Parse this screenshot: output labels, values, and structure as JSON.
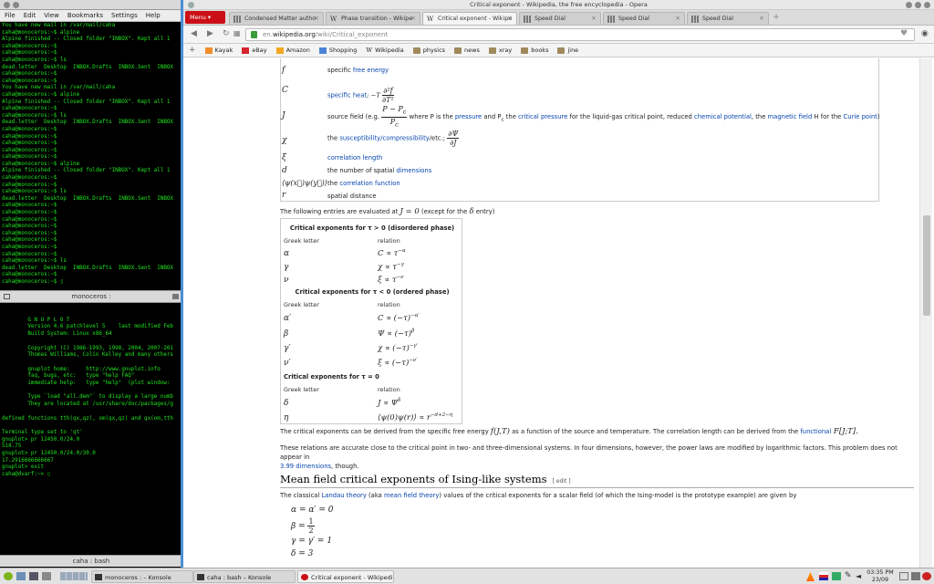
{
  "terminal": {
    "menu": [
      "File",
      "Edit",
      "View",
      "Bookmarks",
      "Settings",
      "Help"
    ],
    "upper_lines": [
      "You have new mail in /var/mail/caha",
      "caha@monoceros:~$ alpine",
      "Alpine finished -- Closed folder \"INBOX\". Kept all 1",
      "caha@monoceros:~$",
      "caha@monoceros:~$",
      "caha@monoceros:~$ ls",
      "dead.letter  Desktop  INBOX.Drafts  INBOX.Sent  INBOX",
      "caha@monoceros:~$",
      "caha@monoceros:~$",
      "You have new mail in /var/mail/caha",
      "caha@monoceros:~$ alpine",
      "Alpine finished -- Closed folder \"INBOX\". Kept all 1",
      "caha@monoceros:~$",
      "caha@monoceros:~$ ls",
      "dead.letter  Desktop  INBOX.Drafts  INBOX.Sent  INBOX",
      "caha@monoceros:~$",
      "caha@monoceros:~$",
      "caha@monoceros:~$",
      "caha@monoceros:~$",
      "caha@monoceros:~$",
      "caha@monoceros:~$ alpine",
      "Alpine finished -- Closed folder \"INBOX\". Kept all 1",
      "caha@monoceros:~$",
      "caha@monoceros:~$",
      "caha@monoceros:~$ ls",
      "dead.letter  Desktop  INBOX.Drafts  INBOX.Sent  INBOX",
      "caha@monoceros:~$",
      "caha@monoceros:~$",
      "caha@monoceros:~$",
      "caha@monoceros:~$",
      "caha@monoceros:~$",
      "caha@monoceros:~$",
      "caha@monoceros:~$",
      "caha@monoceros:~$",
      "caha@monoceros:~$ ls",
      "dead.letter  Desktop  INBOX.Drafts  INBOX.Sent  INBOX",
      "caha@monoceros:~$",
      "caha@monoceros:~$ ▯"
    ],
    "upper_title": "monoceros :",
    "lower_lines": [
      "",
      "        G N U P L O T",
      "        Version 4.6 patchlevel 5    last modified Feb",
      "        Build System: Linux x86_64",
      "",
      "        Copyright (C) 1986-1993, 1998, 2004, 2007-201",
      "        Thomas Williams, Colin Kelley and many others",
      "",
      "        gnuplot home:     http://www.gnuplot.info",
      "        faq, bugs, etc:   type \"help FAQ\"",
      "        immediate help:   type \"help\"  (plot window:",
      "",
      "        Type `load \"all.dem\"` to display a large numb",
      "        They are located at /usr/share/doc/packages/g",
      "",
      "defined functions tth(qx,qz), om(qx,qz) and qx(om,tth",
      "",
      "Terminal type set to 'qt'",
      "gnuplot> pr 12450.0/24.0",
      "518.75",
      "gnuplot> pr 12450.0/24.0/30.0",
      "17.2916666666667",
      "gnuplot> exit",
      "caha@dvarf:~> ▯"
    ],
    "lower_title": "caha : bash"
  },
  "browser": {
    "window_title": "Critical exponent - Wikipedia, the free encyclopedia - Opera",
    "menu_button": "Menu",
    "tabs": [
      {
        "label": "Condensed Matter autho",
        "icon": "grid-favicon",
        "active": false
      },
      {
        "label": "Phase transition - Wikipe",
        "icon": "wikipedia-favicon",
        "active": false
      },
      {
        "label": "Critical exponent - Wikipe",
        "icon": "wikipedia-favicon",
        "active": true
      },
      {
        "label": "Speed Dial",
        "icon": "speed-dial-icon",
        "active": false
      },
      {
        "label": "Speed Dial",
        "icon": "speed-dial-icon",
        "active": false
      },
      {
        "label": "Speed Dial",
        "icon": "speed-dial-icon",
        "active": false
      }
    ],
    "url_prefix": "en.",
    "url_domain": "wikipedia.org",
    "url_path": "/wiki/Critical_exponent",
    "bookmarks": [
      "Kayak",
      "eBay",
      "Amazon",
      "Shopping",
      "Wikipedia",
      "physics",
      "news",
      "xray",
      "books",
      "jine"
    ]
  },
  "article": {
    "defs": [
      {
        "sym": "f",
        "pre": "specific ",
        "link": "free energy",
        "post": ""
      },
      {
        "sym": "C",
        "pre": "",
        "link": "specific heat",
        "post": "; −T"
      },
      {
        "sym": "J",
        "pre": "source field (e.g. ",
        "post": " where P is the ",
        "l1": "pressure",
        "m1": " and P",
        "m1sub": "c",
        "m2": " the ",
        "l2": "critical pressure",
        "m3": " for the liquid-gas critical point, reduced ",
        "l3": "chemical potential",
        "m4": ", the ",
        "l4": "magnetic field",
        "m5": " H for the ",
        "l5": "Curie point",
        "m6": ")"
      },
      {
        "sym": "χ",
        "pre": "the ",
        "link": "susceptibility/compressibility",
        "post": "/etc.;"
      },
      {
        "sym": "ξ",
        "pre": "",
        "link": "correlation length",
        "post": ""
      },
      {
        "sym": "d",
        "pre": "the number of spatial ",
        "link": "dimensions",
        "post": ""
      },
      {
        "sym": "⟨ψ(x⃗)ψ(y⃗)⟩",
        "pre": "the ",
        "link": "correlation function",
        "post": ""
      },
      {
        "sym": "r",
        "pre": "spatial distance",
        "link": "",
        "post": ""
      }
    ],
    "intro_pre": "The following entries are evaluated at ",
    "intro_eq": "J = 0",
    "intro_mid": " (except for the ",
    "intro_delta": "δ",
    "intro_post": " entry)",
    "tables": {
      "h1": "Critical exponents for τ > 0 (disordered phase)",
      "h2": "Critical exponents for τ < 0 (ordered phase)",
      "h3": "Critical exponents for τ = 0",
      "col_letter": "Greek letter",
      "col_relation": "relation",
      "rows1": [
        {
          "g": "α",
          "r": "C ∝ τ",
          "e": "−α"
        },
        {
          "g": "γ",
          "r": "χ ∝ τ",
          "e": "−γ"
        },
        {
          "g": "ν",
          "r": "ξ ∝ τ",
          "e": "−ν"
        }
      ],
      "rows2": [
        {
          "g": "α′",
          "r": "C ∝ (−τ)",
          "e": "−α′"
        },
        {
          "g": "β",
          "r": "Ψ ∝ (−τ)",
          "e": "β"
        },
        {
          "g": "γ′",
          "r": "χ ∝ (−τ)",
          "e": "−γ′"
        },
        {
          "g": "ν′",
          "r": "ξ ∝ (−τ)",
          "e": "−ν′"
        }
      ],
      "rows3": [
        {
          "g": "δ",
          "r": "J ∝ Ψ",
          "e": "δ"
        },
        {
          "g": "η",
          "r": "⟨ψ(0)ψ(r)⟩ ∝ r",
          "e": "−d+2−η"
        }
      ]
    },
    "p1_a": "The critical exponents can be derived from the specific free energy ",
    "p1_eq": "f(J,T)",
    "p1_b": " as a function of the source and temperature. The correlation length can be derived from the ",
    "p1_link": "functional",
    "p1_eq2": " F[J;T].",
    "p2_a": "These relations are accurate close to the critical point in two- and three-dimensional systems. In four dimensions, however, the power laws are modified by logarithmic factors. This problem does not appear in",
    "p2_link": "3.99 dimensions",
    "p2_b": ", though.",
    "mf_heading": "Mean field critical exponents of Ising-like systems",
    "mf_edit": "[ edit ]",
    "p3_a": "The classical ",
    "p3_l1": "Landau theory",
    "p3_b": " (aka ",
    "p3_l2": "mean field theory",
    "p3_c": ") values of the critical exponents for a scalar field (of which the Ising-model is the prototype example) are given by",
    "eq1": "α = α′ = 0",
    "eq2_a": "β =",
    "eq2_num": "1",
    "eq2_den": "2",
    "eq3": "γ = γ′ = 1",
    "eq4": "δ = 3"
  },
  "taskbar": {
    "tasks": [
      "monoceros : – Konsole",
      "caha : bash – Konsole",
      "Critical exponent - Wikipedia, th"
    ],
    "time": "03:35 PM",
    "date": "23/09"
  }
}
